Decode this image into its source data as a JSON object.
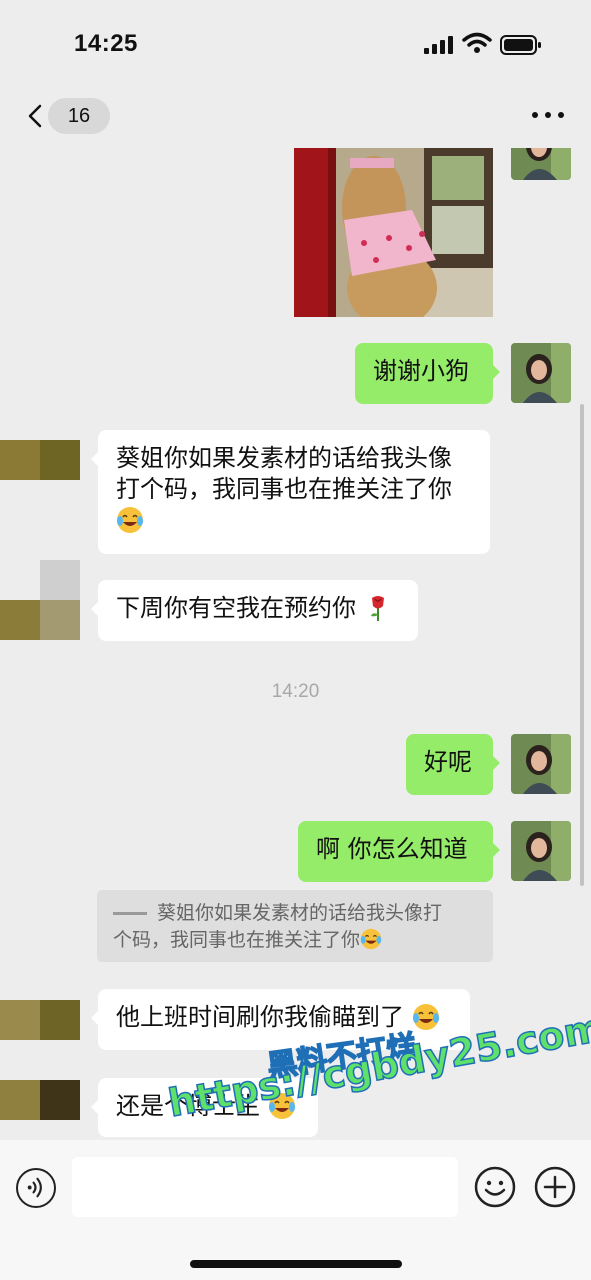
{
  "status_bar": {
    "time": "14:25"
  },
  "nav": {
    "unread_count": "16"
  },
  "messages": {
    "m1": "谢谢小狗",
    "m2_line1": "葵姐你如果发素材的话给我头像",
    "m2_line2": "打个码，我同事也在推关注了你",
    "m3": "下周你有空我在预约你",
    "timestamp": "14:20",
    "m4": "好呢",
    "m5": "啊 你怎么知道",
    "quote_line1": "葵姐你如果发素材的话给我头像打",
    "quote_line2": "个码，我同事也在推关注了你",
    "m6": "他上班时间刷你我偷瞄到了",
    "m7": "还是个博士生"
  },
  "input": {
    "value": "",
    "placeholder": ""
  },
  "watermark": {
    "line1": "黑料不打烊",
    "line2": "https://cgbdy25.com"
  },
  "colors": {
    "outgoing_bubble": "#95ec69",
    "incoming_bubble": "#ffffff",
    "background": "#ededed",
    "watermark_fill": "#5ee06a"
  },
  "icons": {
    "back": "chevron-left-icon",
    "more": "more-dots-icon",
    "voice": "voice-icon",
    "emoji": "emoji-icon",
    "plus": "plus-icon",
    "laugh_cry": "laugh-cry-emoji",
    "rose": "rose-emoji"
  }
}
